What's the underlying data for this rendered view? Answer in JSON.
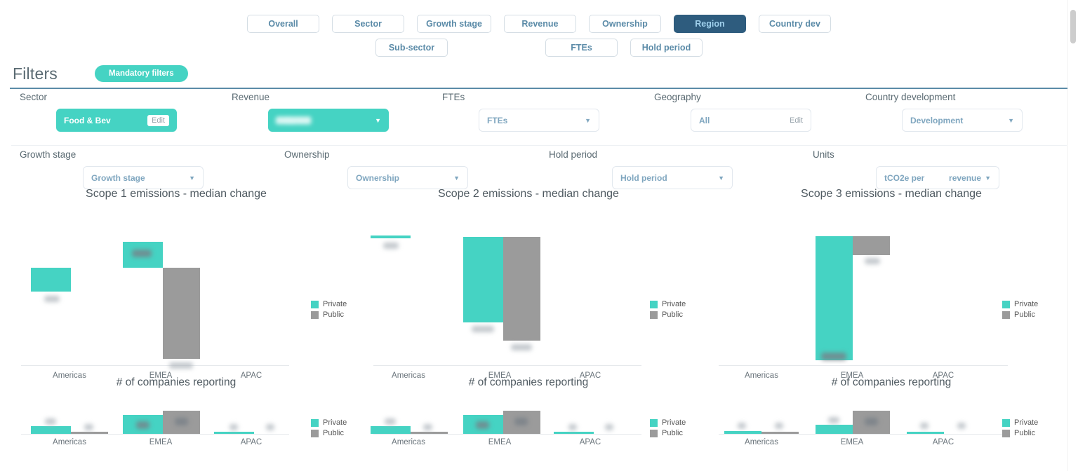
{
  "nav": {
    "row1": [
      {
        "label": "Overall",
        "active": false
      },
      {
        "label": "Sector",
        "active": false
      },
      {
        "label": "Growth stage",
        "active": false
      },
      {
        "label": "Revenue",
        "active": false
      },
      {
        "label": "Ownership",
        "active": false
      },
      {
        "label": "Region",
        "active": true
      },
      {
        "label": "Country dev",
        "active": false
      }
    ],
    "row2": [
      {
        "label": "Sub-sector",
        "active": false
      },
      {
        "label": "FTEs",
        "active": false
      },
      {
        "label": "Hold period",
        "active": false
      }
    ]
  },
  "filters": {
    "title": "Filters",
    "mandatory_badge": "Mandatory filters",
    "row1": [
      {
        "label": "Sector",
        "value": "Food & Bev",
        "action": "Edit",
        "style": "teal-pill"
      },
      {
        "label": "Revenue",
        "value": "",
        "action": "",
        "style": "teal-dropdown",
        "blurred": true
      },
      {
        "label": "FTEs",
        "value": "FTEs",
        "action": "",
        "style": "dropdown"
      },
      {
        "label": "Geography",
        "value": "All",
        "action": "Edit",
        "style": "edit-box"
      },
      {
        "label": "Country development",
        "value": "Development",
        "action": "",
        "style": "dropdown"
      }
    ],
    "row2": [
      {
        "label": "Growth stage",
        "value": "Growth stage",
        "action": "",
        "style": "dropdown"
      },
      {
        "label": "Ownership",
        "value": "Ownership",
        "action": "",
        "style": "dropdown"
      },
      {
        "label": "Hold period",
        "value": "Hold period",
        "action": "",
        "style": "dropdown"
      },
      {
        "label": "Units",
        "value": "tCO2e per ███ revenue",
        "action": "",
        "style": "dropdown"
      }
    ]
  },
  "legend": {
    "private": "Private",
    "public": "Public"
  },
  "chart_data": [
    {
      "type": "bar",
      "title": "Scope 1 emissions - median change",
      "categories": [
        "Americas",
        "EMEA",
        "APAC"
      ],
      "series": [
        {
          "name": "Private",
          "color": "#45d3c3",
          "values": [
            -22,
            28,
            0
          ]
        },
        {
          "name": "Public",
          "color": "#9b9b9b",
          "values": [
            0,
            -94,
            0
          ]
        }
      ],
      "xlabel": "",
      "ylabel": "",
      "grid": false,
      "legend_position": "right",
      "labels_redacted": true,
      "note": "diverging bars from zero baseline; value labels blurred in source"
    },
    {
      "type": "bar",
      "title": "Scope 2 emissions - median change",
      "categories": [
        "Americas",
        "EMEA",
        "APAC"
      ],
      "series": [
        {
          "name": "Private",
          "color": "#45d3c3",
          "values": [
            -1,
            -88,
            0
          ]
        },
        {
          "name": "Public",
          "color": "#9b9b9b",
          "values": [
            0,
            -118,
            0
          ]
        }
      ],
      "xlabel": "",
      "ylabel": "",
      "grid": false,
      "legend_position": "right",
      "labels_redacted": true
    },
    {
      "type": "bar",
      "title": "Scope 3 emissions - median change",
      "categories": [
        "Americas",
        "EMEA",
        "APAC"
      ],
      "series": [
        {
          "name": "Private",
          "color": "#45d3c3",
          "values": [
            0,
            -160,
            0
          ]
        },
        {
          "name": "Public",
          "color": "#9b9b9b",
          "values": [
            0,
            -22,
            0
          ]
        }
      ],
      "xlabel": "",
      "ylabel": "",
      "grid": false,
      "legend_position": "right",
      "labels_redacted": true
    },
    {
      "type": "bar",
      "title": "# of companies reporting",
      "categories": [
        "Americas",
        "EMEA",
        "APAC"
      ],
      "series": [
        {
          "name": "Private",
          "color": "#45d3c3",
          "values": [
            12,
            29,
            1
          ]
        },
        {
          "name": "Public",
          "color": "#9b9b9b",
          "values": [
            2,
            33,
            0
          ]
        }
      ],
      "xlabel": "",
      "ylabel": "",
      "grid": false,
      "legend_position": "right",
      "labels_redacted": true
    },
    {
      "type": "bar",
      "title": "# of companies reporting",
      "categories": [
        "Americas",
        "EMEA",
        "APAC"
      ],
      "series": [
        {
          "name": "Private",
          "color": "#45d3c3",
          "values": [
            12,
            29,
            1
          ]
        },
        {
          "name": "Public",
          "color": "#9b9b9b",
          "values": [
            2,
            33,
            0
          ]
        }
      ],
      "xlabel": "",
      "ylabel": "",
      "grid": false,
      "legend_position": "right",
      "labels_redacted": true
    },
    {
      "type": "bar",
      "title": "# of companies reporting",
      "categories": [
        "Americas",
        "EMEA",
        "APAC"
      ],
      "series": [
        {
          "name": "Private",
          "color": "#45d3c3",
          "values": [
            3,
            14,
            1
          ]
        },
        {
          "name": "Public",
          "color": "#9b9b9b",
          "values": [
            3,
            33,
            0
          ]
        }
      ],
      "xlabel": "",
      "ylabel": "",
      "grid": false,
      "legend_position": "right",
      "labels_redacted": true
    }
  ],
  "colors": {
    "teal": "#45d3c3",
    "grey": "#9b9b9b",
    "active_nav_bg": "#2e5c7e",
    "active_nav_text": "#9fd0ec",
    "nav_text": "#5b8ba8",
    "divider": "#5b8ba8"
  }
}
